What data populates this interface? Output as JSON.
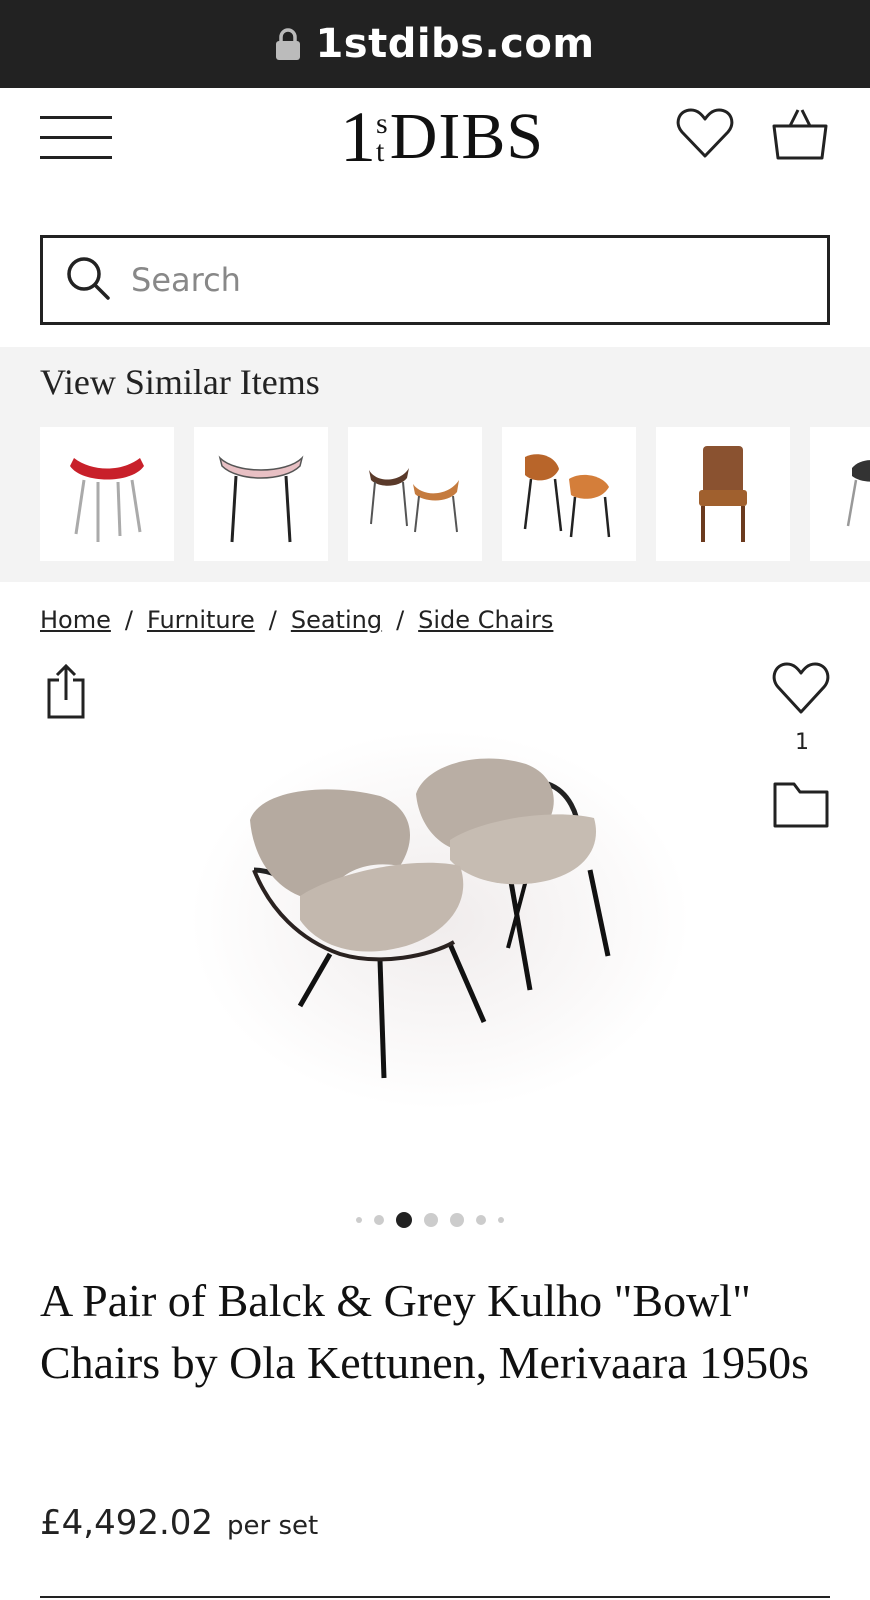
{
  "browser": {
    "url": "1stdibs.com"
  },
  "header": {
    "logo_number": "1",
    "logo_super": "s",
    "logo_sub": "t",
    "logo_word": "DIBS"
  },
  "search": {
    "placeholder": "Search"
  },
  "similar": {
    "heading": "View Similar Items",
    "items": [
      {
        "icon": "red-bowl-stool-thumbnail"
      },
      {
        "icon": "pink-bowl-stool-thumbnail"
      },
      {
        "icon": "pair-dark-bowl-chairs-thumbnail"
      },
      {
        "icon": "pair-wood-bowl-chairs-thumbnail"
      },
      {
        "icon": "brown-leather-chair-thumbnail"
      },
      {
        "icon": "black-bowl-chair-thumbnail"
      }
    ]
  },
  "breadcrumb": {
    "items": [
      "Home",
      "Furniture",
      "Seating",
      "Side Chairs"
    ],
    "separator": "/"
  },
  "product": {
    "like_count": "1",
    "title": "A Pair of Balck & Grey Kulho \"Bowl\" Chairs by Ola Kettunen, Merivaara 1950s",
    "price": "£4,492.02",
    "price_unit": "per set",
    "image_icon": "pair-grey-bowl-chairs-photo",
    "carousel": {
      "total": 7,
      "active_index": 2
    }
  },
  "colors": {
    "text": "#222222",
    "urlbar": "#222222",
    "panel": "#f3f3f3"
  }
}
